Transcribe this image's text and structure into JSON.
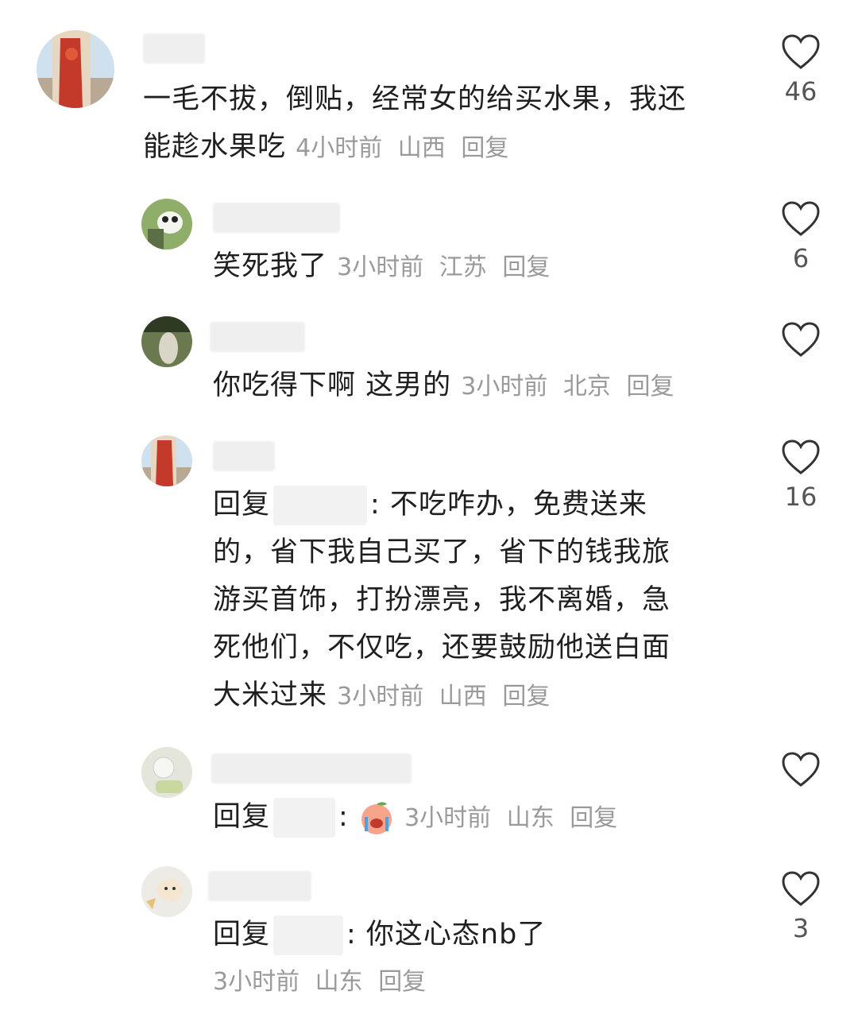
{
  "comments": [
    {
      "text": "一毛不拔，倒贴，经常女的给买水果，我还",
      "text2": "能趁水果吃",
      "time": "4小时前",
      "location": "山西",
      "reply_label": "回复",
      "likes": "46"
    },
    {
      "text": "笑死我了",
      "time": "3小时前",
      "location": "江苏",
      "reply_label": "回复",
      "likes": "6"
    },
    {
      "text": "你吃得下啊 这男的",
      "time": "3小时前",
      "location": "北京",
      "reply_label": "回复",
      "likes": ""
    },
    {
      "prefix": "回复",
      "line1": ": 不吃咋办，免费送来",
      "line2": "的，省下我自己买了，省下的钱我旅",
      "line3": "游买首饰，打扮漂亮，我不离婚，急",
      "line4": "死他们，不仅吃，还要鼓励他送白面",
      "line5": "大米过来",
      "time": "3小时前",
      "location": "山西",
      "reply_label": "回复",
      "likes": "16"
    },
    {
      "prefix": "回复",
      "sep": ":",
      "time": "3小时前",
      "location": "山东",
      "reply_label": "回复",
      "likes": ""
    },
    {
      "prefix": "回复",
      "text": ": 你这心态nb了",
      "time": "3小时前",
      "location": "山东",
      "reply_label": "回复",
      "likes": "3"
    }
  ],
  "icons": {
    "like": "heart-outline-icon"
  },
  "colors": {
    "text": "#1f1f1f",
    "meta": "#9a9a9a",
    "icon": "#333333"
  }
}
